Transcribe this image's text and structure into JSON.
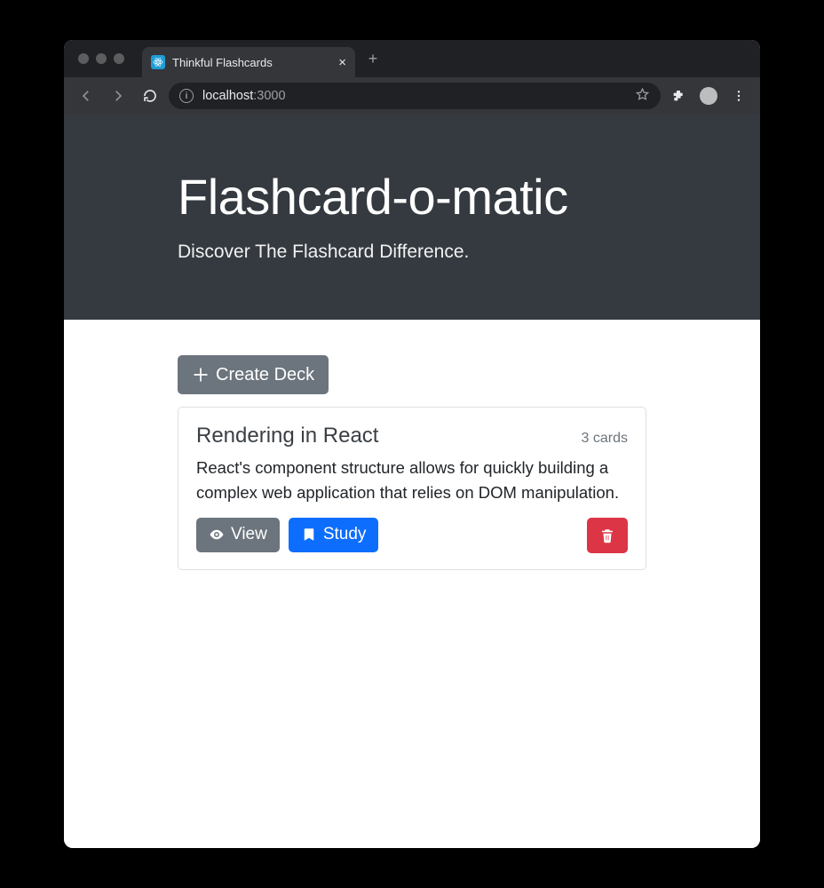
{
  "browser": {
    "tab_title": "Thinkful Flashcards",
    "url_host": "localhost",
    "url_port": ":3000"
  },
  "header": {
    "title": "Flashcard-o-matic",
    "tagline": "Discover The Flashcard Difference."
  },
  "actions": {
    "create_deck_label": "Create Deck"
  },
  "decks": [
    {
      "title": "Rendering in React",
      "count_label": "3 cards",
      "description": "React's component structure allows for quickly building a complex web application that relies on DOM manipulation.",
      "view_label": "View",
      "study_label": "Study"
    }
  ]
}
